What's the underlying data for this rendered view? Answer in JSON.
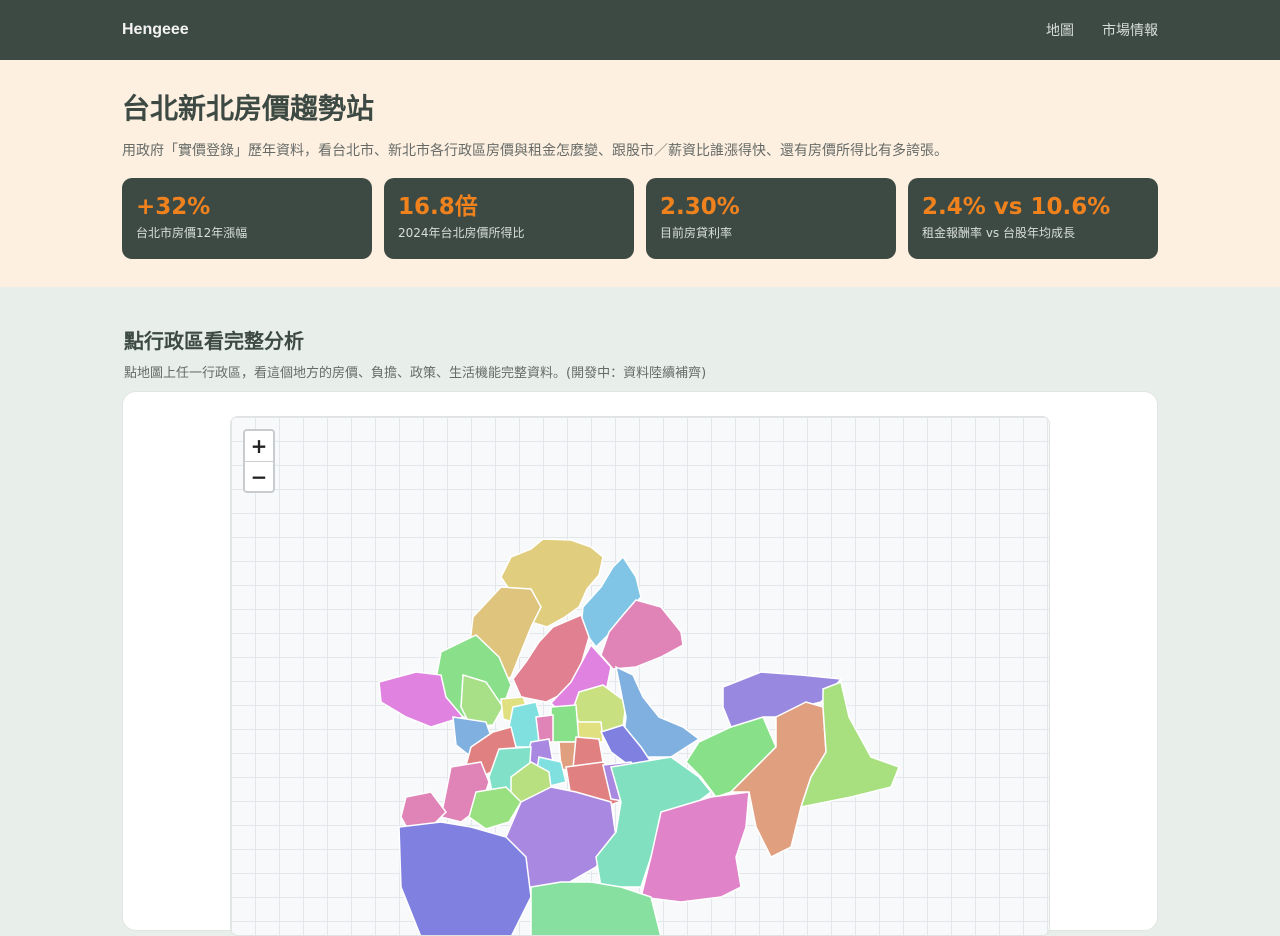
{
  "header": {
    "brand": "Hengeee",
    "nav": [
      "地圖",
      "市場情報"
    ]
  },
  "hero": {
    "title": "台北新北房價趨勢站",
    "subtitle": "用政府「實價登錄」歷年資料，看台北市、新北市各行政區房價與租金怎麼變、跟股市／薪資比誰漲得快、還有房價所得比有多誇張。",
    "stats": [
      {
        "value": "+32%",
        "label": "台北市房價12年漲幅"
      },
      {
        "value": "16.8倍",
        "label": "2024年台北房價所得比"
      },
      {
        "value": "2.30%",
        "label": "目前房貸利率"
      },
      {
        "value": "2.4% vs 10.6%",
        "label": "租金報酬率 vs 台股年均成長"
      }
    ]
  },
  "section": {
    "title": "點行政區看完整分析",
    "description": "點地圖上任一行政區，看這個地方的房價、負擔、政策、生活機能完整資料。(開發中：資料陸續補齊)"
  },
  "map": {
    "zoom_in": "+",
    "zoom_out": "−"
  }
}
